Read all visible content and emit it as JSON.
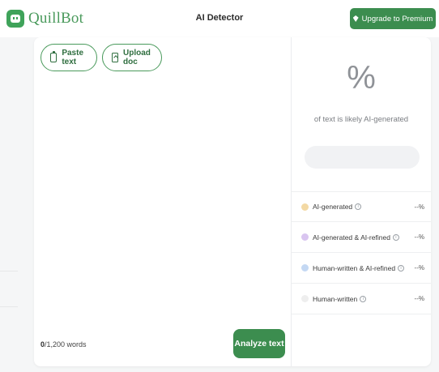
{
  "header": {
    "logo_text": "QuillBot",
    "title": "AI Detector",
    "premium_button": "Upgrade to Premium"
  },
  "editor": {
    "paste_button": "Paste text",
    "upload_button": "Upload doc",
    "word_count_current": "0",
    "word_count_limit": "/1,200 words",
    "analyze_button": "Analyze text"
  },
  "result": {
    "percent_symbol": "%",
    "subtitle": "of text is likely AI-generated",
    "categories": [
      {
        "label": "AI-generated",
        "value": "--%",
        "color": "#f3d9a4"
      },
      {
        "label": "AI-generated & AI-refined",
        "value": "--%",
        "color": "#d9c5f0"
      },
      {
        "label": "Human-written & AI-refined",
        "value": "--%",
        "color": "#c4d8f3"
      },
      {
        "label": "Human-written",
        "value": "--%",
        "color": "#eeeeee"
      }
    ]
  },
  "colors": {
    "brand_green": "#3c8d4f",
    "logo_green": "#4a9a5c"
  },
  "icons": [
    "logo-icon",
    "gem-icon",
    "clipboard-icon",
    "upload-doc-icon",
    "info-icon"
  ]
}
